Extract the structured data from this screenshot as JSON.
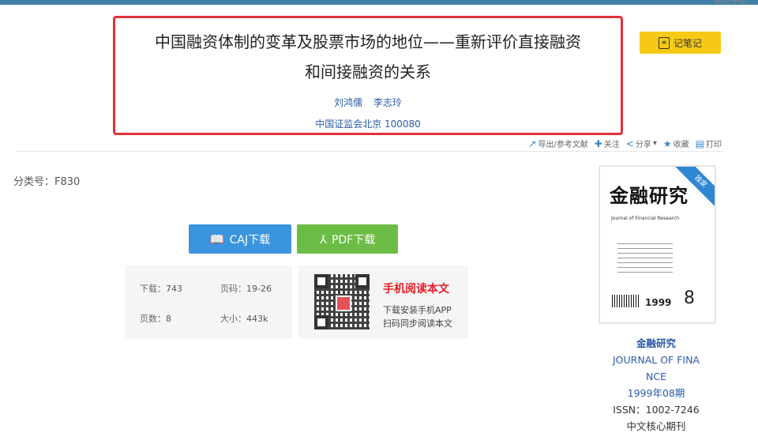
{
  "header": {
    "login_text": "帮助中心"
  },
  "article": {
    "title_line1": "中国融资体制的变革及股票市场的地位——重新评价直接融资",
    "title_line2": "和间接融资的关系",
    "authors": [
      "刘鸿儒",
      "李志玲"
    ],
    "affiliation": "中国证监会北京 100080",
    "classification": "分类号：F830"
  },
  "note_button": {
    "label": "记笔记",
    "icon": "notebook-icon"
  },
  "toolbar": {
    "export_label": "导出/参考文献",
    "follow_label": "关注",
    "share_label": "分享",
    "favorite_label": "收藏",
    "print_label": "打印"
  },
  "downloads": {
    "caj_label": "CAJ下载",
    "pdf_label": "PDF下载"
  },
  "stats": {
    "downloads_label": "下载：",
    "downloads_value": "743",
    "pages_label": "页码：",
    "pages_value": "19-26",
    "page_count_label": "页数：",
    "page_count_value": "8",
    "size_label": "大小：",
    "size_value": "443k"
  },
  "mobile": {
    "title": "手机阅读本文",
    "line1": "下载安装手机APP",
    "line2": "扫码同步阅读本文"
  },
  "journal": {
    "cover_title": "金融研究",
    "cover_subtitle": "Journal of Financial Research",
    "cover_year": "1999",
    "cover_issue": "8",
    "cover_badge": "独家",
    "name_cn": "金融研究",
    "name_en_line1": "JOURNAL OF FINA",
    "name_en_line2": "NCE",
    "issue": "1999年08期",
    "issn": "ISSN：1002-7246",
    "core": "中文核心期刊"
  },
  "colors": {
    "accent_blue": "#3a95de",
    "pdf_green": "#6cbd45",
    "highlight_red": "#e0323a",
    "note_yellow": "#f6c916",
    "link_blue": "#2a5aa8"
  }
}
